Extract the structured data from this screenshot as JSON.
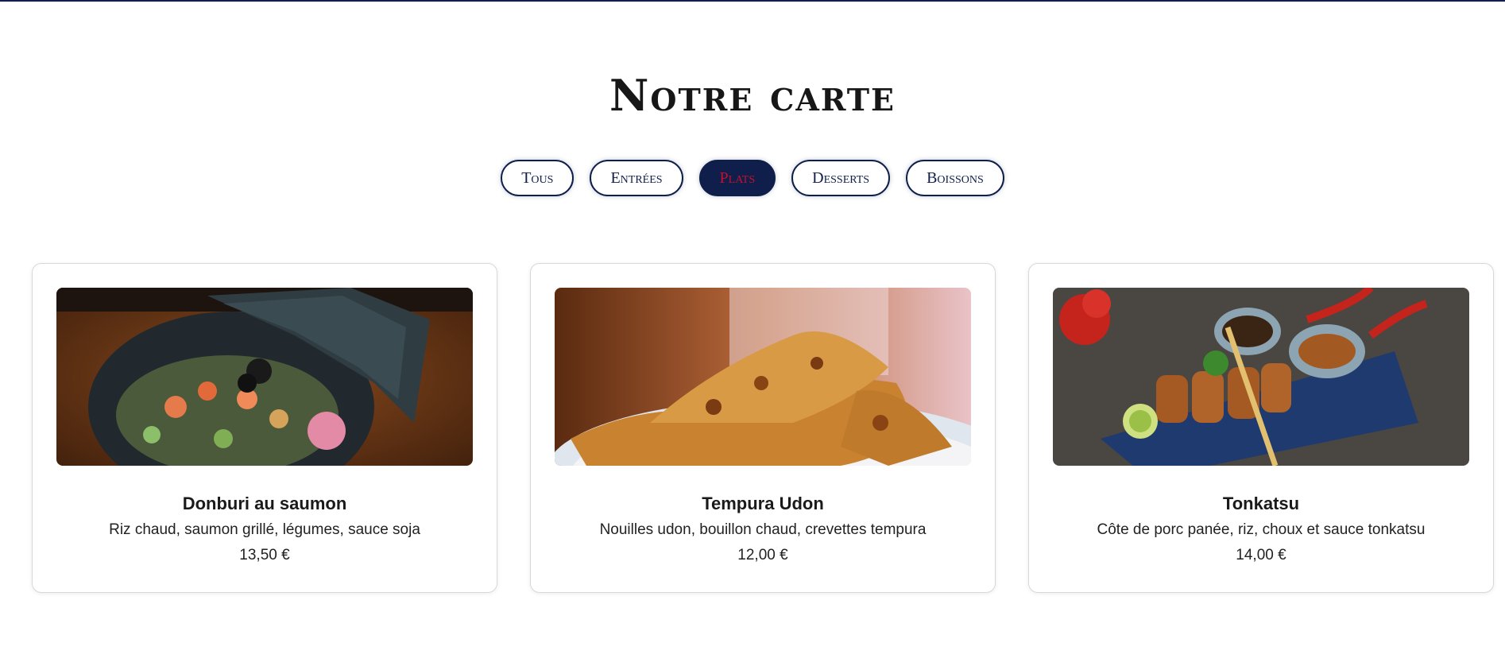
{
  "menu": {
    "title": "Notre carte",
    "filters": [
      {
        "label": "Tous",
        "active": false
      },
      {
        "label": "Entrées",
        "active": false
      },
      {
        "label": "Plats",
        "active": true
      },
      {
        "label": "Desserts",
        "active": false
      },
      {
        "label": "Boissons",
        "active": false
      }
    ],
    "items": [
      {
        "name": "Donburi au saumon",
        "description": "Riz chaud, saumon grillé, légumes, sauce soja",
        "price": "13,50 €",
        "image_icon": "salmon-donburi-photo"
      },
      {
        "name": "Tempura Udon",
        "description": "Nouilles udon, bouillon chaud, crevettes tempura",
        "price": "12,00 €",
        "image_icon": "tempura-photo"
      },
      {
        "name": "Tonkatsu",
        "description": "Côte de porc panée, riz, choux et sauce tonkatsu",
        "price": "14,00 €",
        "image_icon": "tonkatsu-photo"
      }
    ]
  },
  "colors": {
    "accent": "#0f1e4a",
    "active_text": "#c8102e"
  }
}
